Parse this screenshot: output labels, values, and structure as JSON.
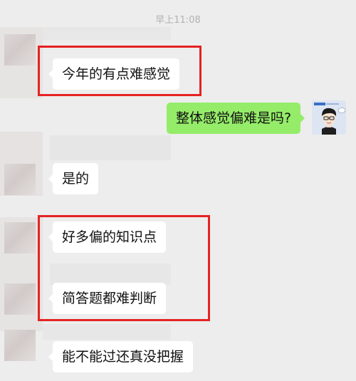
{
  "chat": {
    "timestamp": "早上11:08",
    "messages": [
      {
        "side": "left",
        "text": "今年的有点难感觉"
      },
      {
        "side": "right",
        "text": "整体感觉偏难是吗?"
      },
      {
        "side": "left",
        "text": "是的"
      },
      {
        "side": "left",
        "text": "好多偏的知识点"
      },
      {
        "side": "left",
        "text": "简答题都难判断"
      },
      {
        "side": "left",
        "text": "能不能过还真没把握"
      }
    ]
  },
  "colors": {
    "background": "#ededed",
    "incoming_bubble": "#ffffff",
    "outgoing_bubble": "#95ec69",
    "highlight_box": "#e52222"
  },
  "icons": {
    "self_avatar": "cartoon-boy-avatar-icon"
  }
}
